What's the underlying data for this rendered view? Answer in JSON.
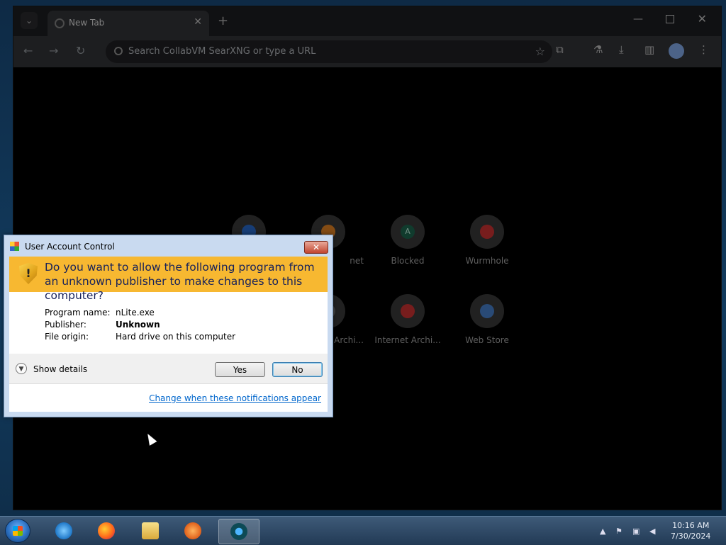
{
  "browser": {
    "tab_title": "New Tab",
    "omnibox_placeholder": "Search CollabVM SearXNG or type a URL",
    "shortcuts": [
      {
        "label": "",
        "color": "#2a6fd6"
      },
      {
        "label": "net",
        "color": "#f08a24"
      },
      {
        "label": "Blocked",
        "color": "#1e6b52",
        "glyph": "A"
      },
      {
        "label": "Wurmhole",
        "color": "#d93434"
      },
      {
        "label": "",
        "color": "#2a6fd6"
      },
      {
        "label": "Archi...",
        "color": "#777"
      },
      {
        "label": "Internet Archi...",
        "color": "#d93434"
      },
      {
        "label": "Web Store",
        "color": "#4a86d6"
      }
    ]
  },
  "uac": {
    "title": "User Account Control",
    "question": "Do you want to allow the following program from an unknown publisher to make changes to this computer?",
    "details": {
      "program_label": "Program name:",
      "program_value": "nLite.exe",
      "publisher_label": "Publisher:",
      "publisher_value": "Unknown",
      "origin_label": "File origin:",
      "origin_value": "Hard drive on this computer"
    },
    "show_details": "Show details",
    "yes_label": "Yes",
    "no_label": "No",
    "link": "Change when these notifications appear",
    "close_glyph": "✕"
  },
  "taskbar": {
    "time": "10:16 AM",
    "date": "7/30/2024"
  },
  "colors": {
    "banner": "#f7b831",
    "link": "#0066cc"
  }
}
